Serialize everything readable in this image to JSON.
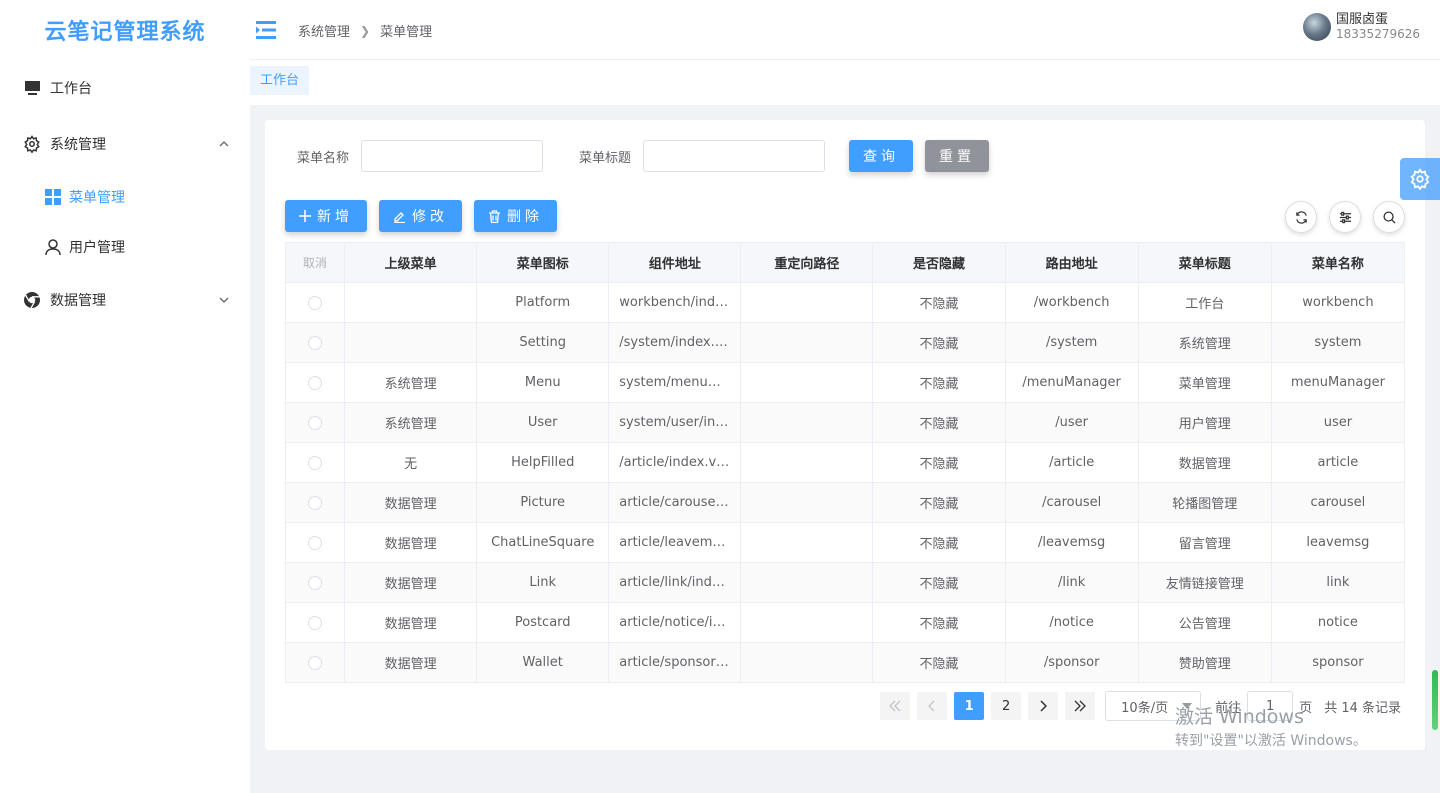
{
  "app": {
    "title": "云笔记管理系统"
  },
  "sidebar": {
    "items": [
      {
        "label": "工作台",
        "icon": "monitor-icon"
      },
      {
        "label": "系统管理",
        "icon": "gear-icon",
        "expanded": true,
        "children": [
          {
            "label": "菜单管理",
            "icon": "grid-icon",
            "active": true
          },
          {
            "label": "用户管理",
            "icon": "user-icon"
          }
        ]
      },
      {
        "label": "数据管理",
        "icon": "chrome-icon",
        "expanded": false
      }
    ]
  },
  "header": {
    "breadcrumb": [
      "系统管理",
      "菜单管理"
    ],
    "user": {
      "name": "国服卤蛋",
      "phone": "18335279626"
    }
  },
  "tags": [
    "工作台"
  ],
  "search": {
    "menu_name_label": "菜单名称",
    "menu_name_value": "",
    "menu_title_label": "菜单标题",
    "menu_title_value": "",
    "query_label": "查询",
    "reset_label": "重置"
  },
  "toolbar": {
    "add_label": "新增",
    "edit_label": "修改",
    "delete_label": "删除"
  },
  "table": {
    "headers": [
      "取消",
      "上级菜单",
      "菜单图标",
      "组件地址",
      "重定向路径",
      "是否隐藏",
      "路由地址",
      "菜单标题",
      "菜单名称"
    ],
    "rows": [
      [
        "",
        "Platform",
        "workbench/index.vue",
        "",
        "不隐藏",
        "/workbench",
        "工作台",
        "workbench"
      ],
      [
        "",
        "Setting",
        "/system/index.vue",
        "",
        "不隐藏",
        "/system",
        "系统管理",
        "system"
      ],
      [
        "系统管理",
        "Menu",
        "system/menuManager/index.vue",
        "",
        "不隐藏",
        "/menuManager",
        "菜单管理",
        "menuManager"
      ],
      [
        "系统管理",
        "User",
        "system/user/index.vue",
        "",
        "不隐藏",
        "/user",
        "用户管理",
        "user"
      ],
      [
        "无",
        "HelpFilled",
        "/article/index.vue",
        "",
        "不隐藏",
        "/article",
        "数据管理",
        "article"
      ],
      [
        "数据管理",
        "Picture",
        "article/carousel/index.vue",
        "",
        "不隐藏",
        "/carousel",
        "轮播图管理",
        "carousel"
      ],
      [
        "数据管理",
        "ChatLineSquare",
        "article/leavemsg/index.vue",
        "",
        "不隐藏",
        "/leavemsg",
        "留言管理",
        "leavemsg"
      ],
      [
        "数据管理",
        "Link",
        "article/link/index.vue",
        "",
        "不隐藏",
        "/link",
        "友情链接管理",
        "link"
      ],
      [
        "数据管理",
        "Postcard",
        "article/notice/index.vue",
        "",
        "不隐藏",
        "/notice",
        "公告管理",
        "notice"
      ],
      [
        "数据管理",
        "Wallet",
        "article/sponsor/index.vue",
        "",
        "不隐藏",
        "/sponsor",
        "赞助管理",
        "sponsor"
      ]
    ]
  },
  "pagination": {
    "pages": [
      "1",
      "2"
    ],
    "current": "1",
    "page_size": "10条/页",
    "goto_label": "前往",
    "goto_value": "1",
    "page_suffix": "页",
    "total_text": "共 14 条记录"
  },
  "watermark": {
    "line1": "激活 Windows",
    "line2": "转到\"设置\"以激活 Windows。"
  },
  "colors": {
    "primary": "#409eff",
    "gray_button": "#909399",
    "background": "#f0f2f5"
  }
}
